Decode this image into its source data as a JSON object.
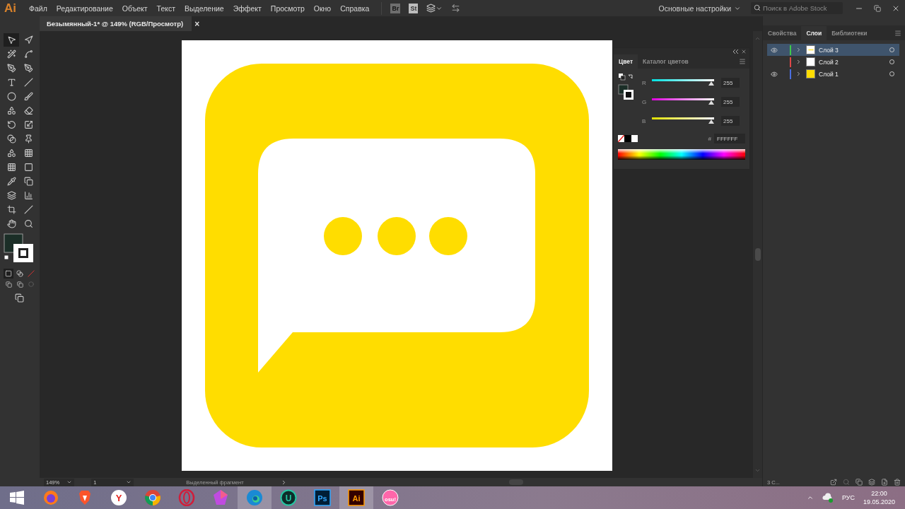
{
  "app_logo": "Ai",
  "menu": [
    "Файл",
    "Редактирование",
    "Объект",
    "Текст",
    "Выделение",
    "Эффект",
    "Просмотр",
    "Окно",
    "Справка"
  ],
  "bridge_badges": [
    "Br",
    "St"
  ],
  "workspace": "Основные настройки",
  "search": {
    "placeholder": "Поиск в Adobe Stock"
  },
  "document_tab": {
    "title": "Безымянный-1* @ 149% (RGB/Просмотр)",
    "close": "×"
  },
  "color_panel": {
    "tabs": [
      {
        "label": "Цвет",
        "selected": true
      },
      {
        "label": "Каталог цветов",
        "selected": false
      }
    ],
    "channels": [
      {
        "name": "R",
        "level": 1,
        "reading": "255"
      },
      {
        "name": "G",
        "level": 1,
        "reading": "255"
      },
      {
        "name": "B",
        "level": 1,
        "reading": "255"
      }
    ],
    "hex_label": "#",
    "hex": "FFFFFF"
  },
  "right_panel": {
    "tabs": [
      {
        "label": "Свойства",
        "selected": false
      },
      {
        "label": "Слои",
        "selected": true
      },
      {
        "label": "Библиотеки",
        "selected": false
      }
    ],
    "layers": [
      {
        "name": "Слой 3",
        "color": "#3ec94a",
        "visible": true,
        "selected": true,
        "kind": "dots"
      },
      {
        "name": "Слой 2",
        "color": "#e04848",
        "visible": false,
        "selected": false,
        "kind": "blank"
      },
      {
        "name": "Слой 1",
        "color": "#4a6ee0",
        "visible": true,
        "selected": false,
        "kind": "filled"
      }
    ],
    "footer": "3 С..."
  },
  "status_bar": {
    "zoom": "149%",
    "artboard": "1",
    "tool": "Выделенный фрагмент"
  },
  "taskbar": {
    "apps": [
      {
        "kind": "firefox",
        "selected": false
      },
      {
        "kind": "brave",
        "selected": false
      },
      {
        "kind": "yandex",
        "label": "Y",
        "selected": false
      },
      {
        "kind": "chrome",
        "selected": false
      },
      {
        "kind": "opera",
        "selected": false
      },
      {
        "kind": "gem",
        "selected": false
      },
      {
        "kind": "edge",
        "selected": true
      },
      {
        "kind": "ring",
        "label": "U",
        "selected": false
      },
      {
        "kind": "square",
        "label": "Ps",
        "selected": false
      },
      {
        "kind": "square-orange",
        "label": "Ai",
        "selected": true
      },
      {
        "kind": "osu",
        "label": "osu!",
        "selected": false
      }
    ],
    "language": "РУС",
    "time": "22:00",
    "date": "19.05.2020"
  }
}
